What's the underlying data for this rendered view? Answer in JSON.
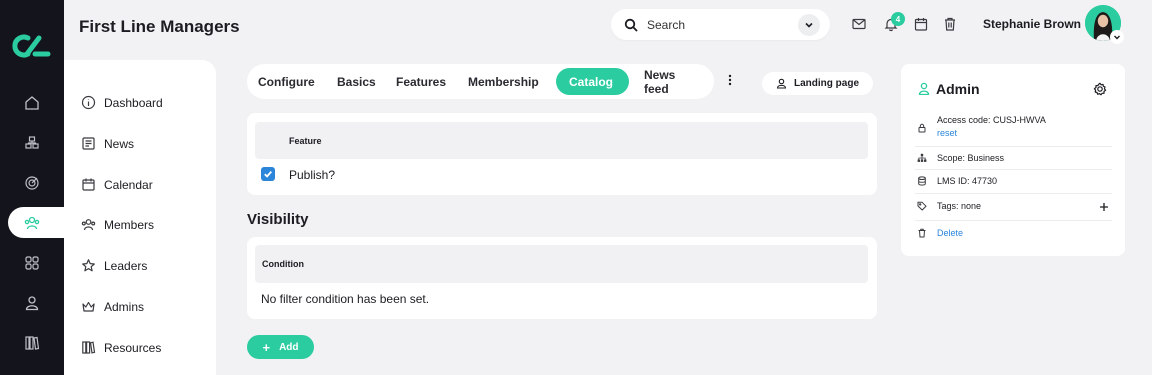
{
  "app": {
    "title": "First Line Managers"
  },
  "search": {
    "placeholder": "Search"
  },
  "notifications": {
    "count": "4"
  },
  "user": {
    "name": "Stephanie Brown"
  },
  "colors": {
    "accent": "#2bcca0",
    "link": "#2b86d9",
    "rail": "#14141c"
  },
  "rail": {
    "icons": [
      "home-icon",
      "network-icon",
      "target-icon",
      "members-icon",
      "grid-icon",
      "user-icon",
      "library-icon"
    ]
  },
  "nav": {
    "items": [
      {
        "label": "Dashboard",
        "icon": "info-icon"
      },
      {
        "label": "News",
        "icon": "newspaper-icon"
      },
      {
        "label": "Calendar",
        "icon": "calendar-icon"
      },
      {
        "label": "Members",
        "icon": "members-icon"
      },
      {
        "label": "Leaders",
        "icon": "star-icon"
      },
      {
        "label": "Admins",
        "icon": "crown-icon"
      },
      {
        "label": "Resources",
        "icon": "books-icon"
      }
    ]
  },
  "tabs": [
    {
      "label": "Configure"
    },
    {
      "label": "Basics"
    },
    {
      "label": "Features"
    },
    {
      "label": "Membership"
    },
    {
      "label": "Catalog",
      "active": true
    },
    {
      "label": "News feed"
    }
  ],
  "landing_page": {
    "label": "Landing page"
  },
  "feature_table": {
    "header": "Feature",
    "rows": [
      {
        "label": "Publish?",
        "checked": true
      }
    ]
  },
  "visibility": {
    "title": "Visibility",
    "header": "Condition",
    "empty_text": "No filter condition has been set."
  },
  "add_button": {
    "label": "Add"
  },
  "admin_panel": {
    "title": "Admin",
    "access_code": "Access code: CUSJ-HWVA",
    "reset_label": "reset",
    "scope": "Scope: Business",
    "lms_id": "LMS ID: 47730",
    "tags": "Tags: none",
    "delete_label": "Delete"
  }
}
